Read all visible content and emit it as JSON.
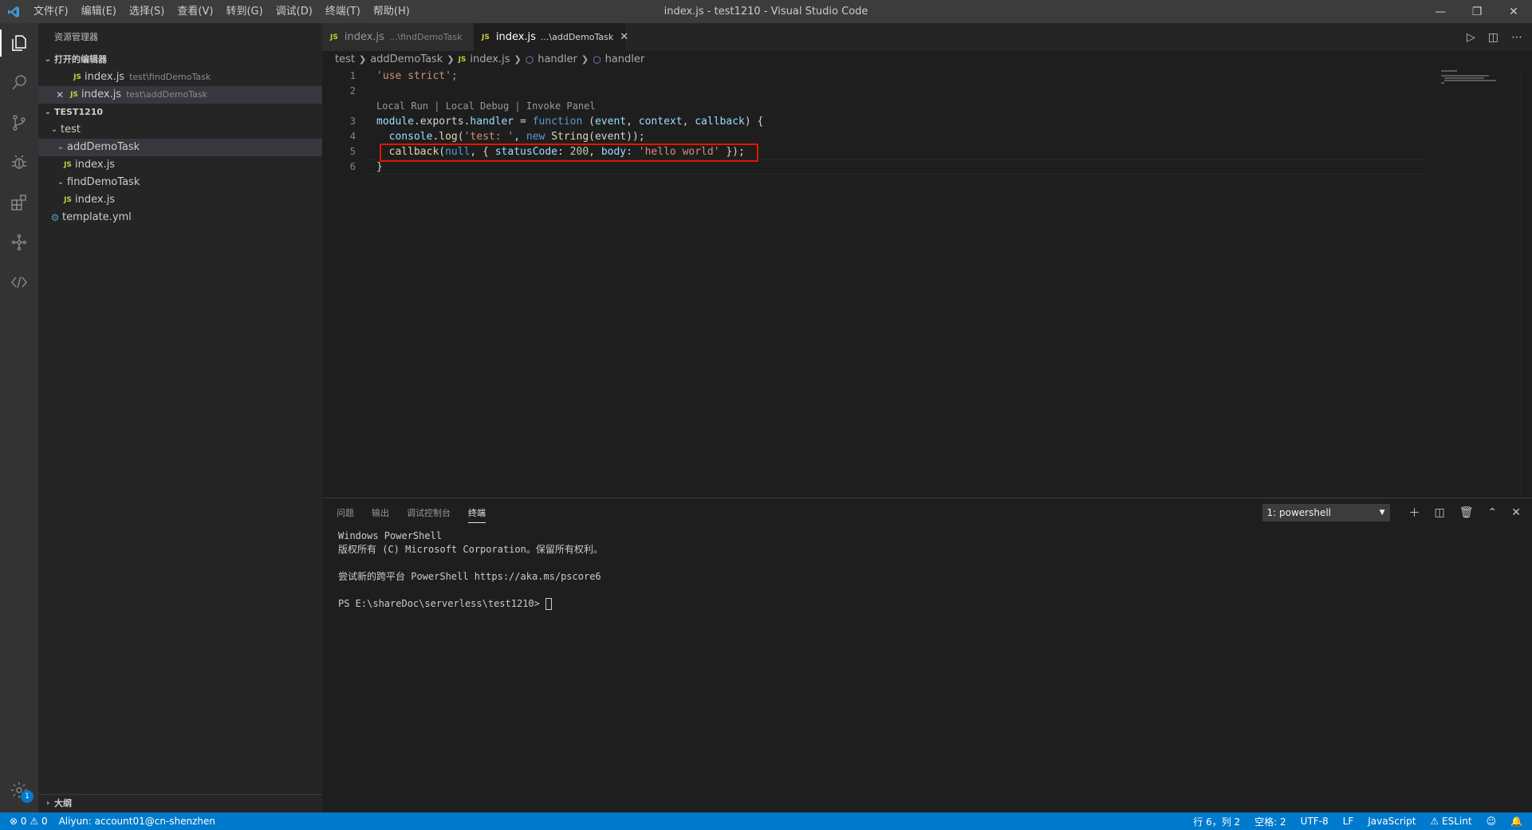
{
  "titlebar": {
    "menu": [
      "文件(F)",
      "编辑(E)",
      "选择(S)",
      "查看(V)",
      "转到(G)",
      "调试(D)",
      "终端(T)",
      "帮助(H)"
    ],
    "title": "index.js - test1210 - Visual Studio Code"
  },
  "sidebar": {
    "title": "资源管理器",
    "open_editors": {
      "header": "打开的编辑器",
      "items": [
        {
          "name": "index.js",
          "path": "test\\findDemoTask"
        },
        {
          "name": "index.js",
          "path": "test\\addDemoTask"
        }
      ]
    },
    "workspace": {
      "header": "TEST1210",
      "items": [
        {
          "label": "test"
        },
        {
          "label": "addDemoTask"
        },
        {
          "label": "index.js"
        },
        {
          "label": "findDemoTask"
        },
        {
          "label": "index.js"
        },
        {
          "label": "template.yml"
        }
      ]
    },
    "outline": "大纲"
  },
  "tabs": [
    {
      "name": "index.js",
      "path": "...\\findDemoTask",
      "active": false
    },
    {
      "name": "index.js",
      "path": "...\\addDemoTask",
      "active": true
    }
  ],
  "breadcrumb": [
    "test",
    "addDemoTask",
    "index.js",
    "handler",
    "handler"
  ],
  "code": {
    "line_numbers": [
      "1",
      "2",
      "3",
      "4",
      "5",
      "6"
    ],
    "codelens": "Local Run | Local Debug | Invoke Panel",
    "l1": "'use strict';",
    "l3": {
      "a": "module",
      "b": ".exports.",
      "c": "handler",
      "d": " = ",
      "e": "function",
      "f": " (",
      "g": "event",
      "h": ", ",
      "i": "context",
      "j": ", ",
      "k": "callback",
      "l": ") {"
    },
    "l4": {
      "a": "  console",
      "b": ".",
      "c": "log",
      "d": "(",
      "e": "'test: '",
      "f": ", ",
      "g": "new",
      "h": " ",
      "i": "String",
      "j": "(event));"
    },
    "l5": {
      "a": "  callback",
      "b": "(",
      "c": "null",
      "d": ", { ",
      "e": "statusCode",
      "f": ": ",
      "g": "200",
      "h": ", ",
      "i": "body",
      "j": ": ",
      "k": "'hello world'",
      "l": " });"
    },
    "l6": "}"
  },
  "panel": {
    "tabs": [
      "问题",
      "输出",
      "调试控制台",
      "终端"
    ],
    "active_tab": "终端",
    "terminal_select": "1: powershell",
    "lines": [
      "Windows PowerShell",
      "版权所有 (C) Microsoft Corporation。保留所有权利。",
      "",
      "尝试新的跨平台 PowerShell https://aka.ms/pscore6",
      "",
      "PS E:\\shareDoc\\serverless\\test1210> "
    ]
  },
  "statusbar": {
    "errors": "0",
    "warnings": "0",
    "account": "Aliyun: account01@cn-shenzhen",
    "position": "行 6，列 2",
    "spaces": "空格: 2",
    "encoding": "UTF-8",
    "eol": "LF",
    "language": "JavaScript",
    "eslint": "ESLint"
  },
  "settings_badge": "1",
  "colors": {
    "accent": "#007acc",
    "highlight_box": "#e51400"
  }
}
